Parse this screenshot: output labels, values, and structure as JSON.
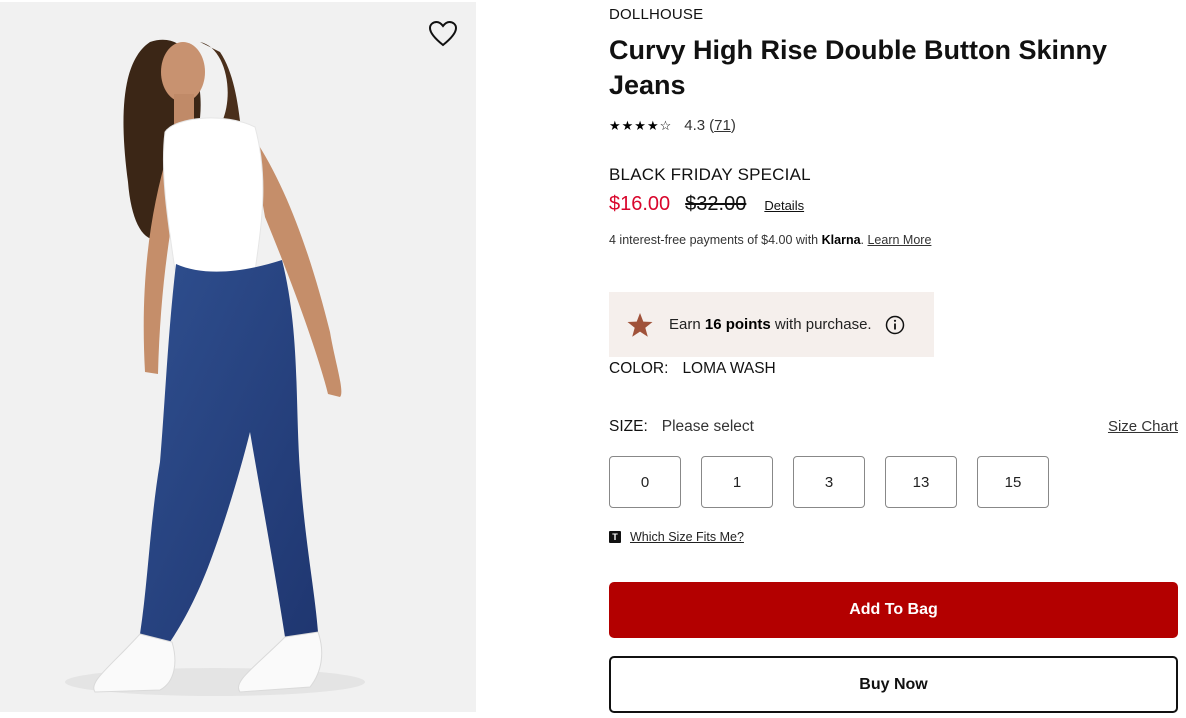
{
  "product": {
    "brand": "DOLLHOUSE",
    "title": "Curvy High Rise Double Button Skinny Jeans",
    "rating": {
      "stars": "★★★★☆",
      "value": "4.3",
      "open_paren": "(",
      "count": "71",
      "close_paren": ")"
    },
    "promo_label": "BLACK FRIDAY SPECIAL",
    "price": {
      "sale": "$16.00",
      "original": "$32.00",
      "details_link": "Details"
    },
    "klarna": {
      "prefix": "4 interest-free payments of $4.00 with ",
      "brand": "Klarna",
      "dot": ". ",
      "learn_more": "Learn More"
    },
    "points": {
      "prefix": "Earn ",
      "amount": "16 points",
      "suffix": " with purchase."
    },
    "color": {
      "label": "COLOR:",
      "value": "LOMA WASH"
    },
    "size": {
      "label": "SIZE:",
      "value": "Please select",
      "chart_link": "Size Chart",
      "options": [
        "0",
        "1",
        "3",
        "13",
        "15"
      ]
    },
    "fit": {
      "logo": "T",
      "link": "Which Size Fits Me?"
    },
    "actions": {
      "add_to_bag": "Add To Bag",
      "buy_now": "Buy Now"
    }
  },
  "icons": {
    "wishlist": "heart-outline-icon",
    "points": "star-icon",
    "info": "info-circle-icon"
  },
  "colors": {
    "sale_price": "#d9062c",
    "add_to_bag_bg": "#b30000",
    "points_bg": "#f5efec",
    "points_star": "#a0523a"
  }
}
